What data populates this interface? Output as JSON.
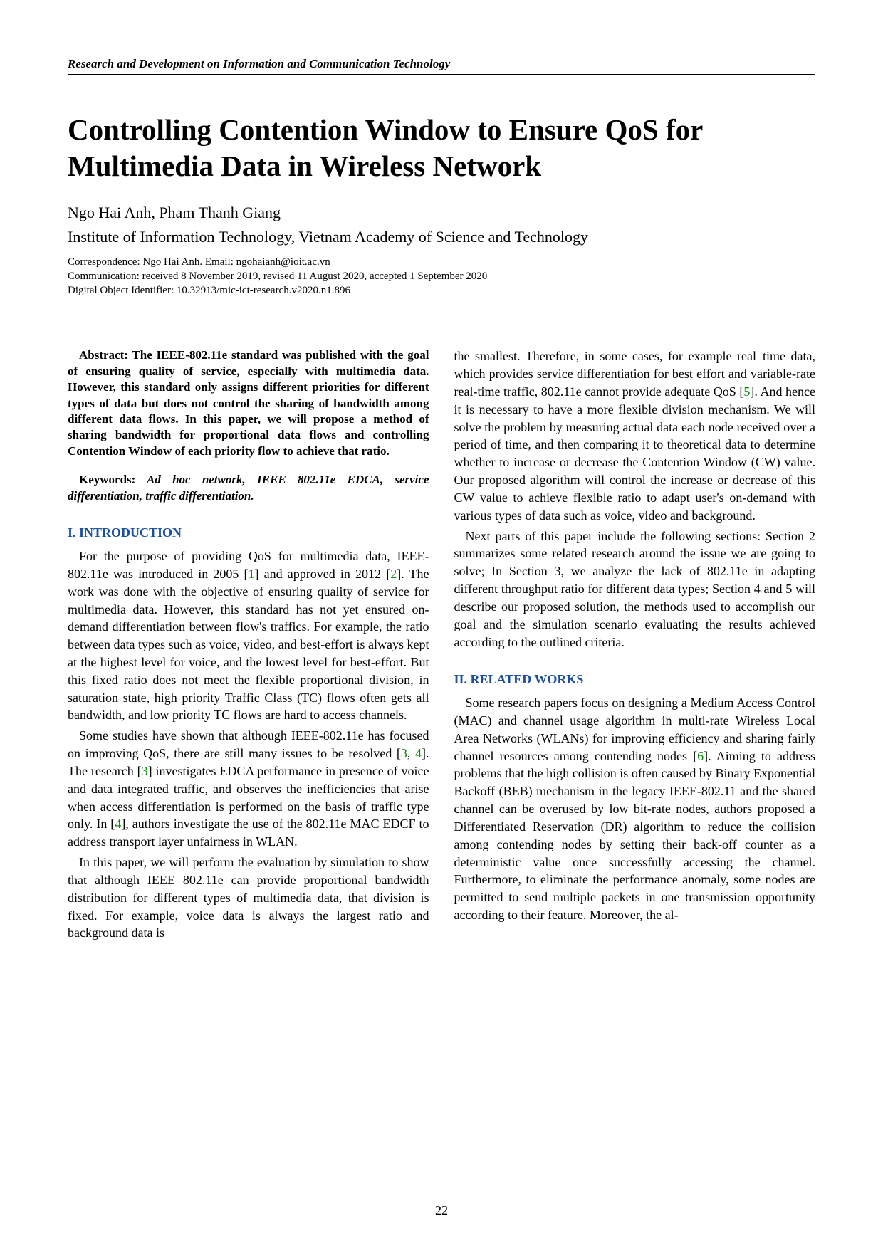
{
  "journal": "Research and Development on Information and Communication Technology",
  "title": "Controlling Contention Window to Ensure QoS for Multimedia Data in Wireless Network",
  "authors": "Ngo Hai Anh, Pham Thanh Giang",
  "affiliation": "Institute of Information Technology, Vietnam Academy of Science and Technology",
  "correspondence": "Correspondence: Ngo Hai Anh. Email: ngohaianh@ioit.ac.vn",
  "communication": "Communication: received 8 November 2019, revised 11 August 2020, accepted 1 September 2020",
  "doi": "Digital Object Identifier: 10.32913/mic-ict-research.v2020.n1.896",
  "abstract_label": "Abstract:",
  "abstract": " The IEEE-802.11e standard was published with the goal of ensuring quality of service, especially with multimedia data. However, this standard only assigns different priorities for different types of data but does not control the sharing of bandwidth among different data flows. In this paper, we will propose a method of sharing bandwidth for proportional data flows and controlling Contention Window of each priority flow to achieve that ratio.",
  "keywords_label": "Keywords:",
  "keywords": " Ad hoc network, IEEE 802.11e EDCA, service differentiation, traffic differentiation.",
  "sections": {
    "intro_heading": "I. INTRODUCTION",
    "related_heading": "II. RELATED WORKS"
  },
  "paras": {
    "p1a": "For the purpose of providing QoS for multimedia data, IEEE-802.11e was introduced in 2005 [",
    "p1b": "] and approved in 2012 [",
    "p1c": "]. The work was done with the objective of ensuring quality of service for multimedia data. However, this standard has not yet ensured on-demand differentiation between flow's traffics. For example, the ratio between data types such as voice, video, and best-effort is always kept at the highest level for voice, and the lowest level for best-effort. But this fixed ratio does not meet the flexible proportional division, in saturation state, high priority Traffic Class (TC) flows often gets all bandwidth, and low priority TC flows are hard to access channels.",
    "p2a": "Some studies have shown that although IEEE-802.11e has focused on improving QoS, there are still many issues to be resolved [",
    "p2b": "]. The research [",
    "p2c": "] investigates EDCA performance in presence of voice and data integrated traffic, and observes the inefficiencies that arise when access differentiation is performed on the basis of traffic type only. In [",
    "p2d": "], authors investigate the use of the 802.11e MAC EDCF to address transport layer unfairness in WLAN.",
    "p3": "In this paper, we will perform the evaluation by simulation to show that although IEEE 802.11e can provide proportional bandwidth distribution for different types of multimedia data, that division is fixed. For example, voice data is always the largest ratio and background data is",
    "p4a": "the smallest. Therefore, in some cases, for example real–time data, which provides service differentiation for best effort and variable-rate real-time traffic, 802.11e cannot provide adequate QoS [",
    "p4b": "]. And hence it is necessary to have a more flexible division mechanism. We will solve the problem by measuring actual data each node received over a period of time, and then comparing it to theoretical data to determine whether to increase or decrease the Contention Window (CW) value. Our proposed algorithm will control the increase or decrease of this CW value to achieve flexible ratio to adapt user's on-demand with various types of data such as voice, video and background.",
    "p5": "Next parts of this paper include the following sections: Section 2 summarizes some related research around the issue we are going to solve; In Section 3, we analyze the lack of 802.11e in adapting different throughput ratio for different data types; Section 4 and 5 will describe our proposed solution, the methods used to accomplish our goal and the simulation scenario evaluating the results achieved according to the outlined criteria.",
    "p6a": "Some research papers focus on designing a Medium Access Control (MAC) and channel usage algorithm in multi-rate Wireless Local Area Networks (WLANs) for improving efficiency and sharing fairly channel resources among contending nodes [",
    "p6b": "]. Aiming to address problems that the high collision is often caused by Binary Exponential Backoff (BEB) mechanism in the legacy IEEE-802.11 and the shared channel can be overused by low bit-rate nodes, authors proposed a Differentiated Reservation (DR) algorithm to reduce the collision among contending nodes by setting their back-off counter as a deterministic value once successfully accessing the channel. Furthermore, to eliminate the performance anomaly, some nodes are permitted to send multiple packets in one transmission opportunity according to their feature. Moreover, the al-"
  },
  "cites": {
    "c1": "1",
    "c2": "2",
    "c34a": "3",
    "c34b": "4",
    "c3": "3",
    "c4": "4",
    "c5": "5",
    "c6": "6"
  },
  "page_number": "22"
}
